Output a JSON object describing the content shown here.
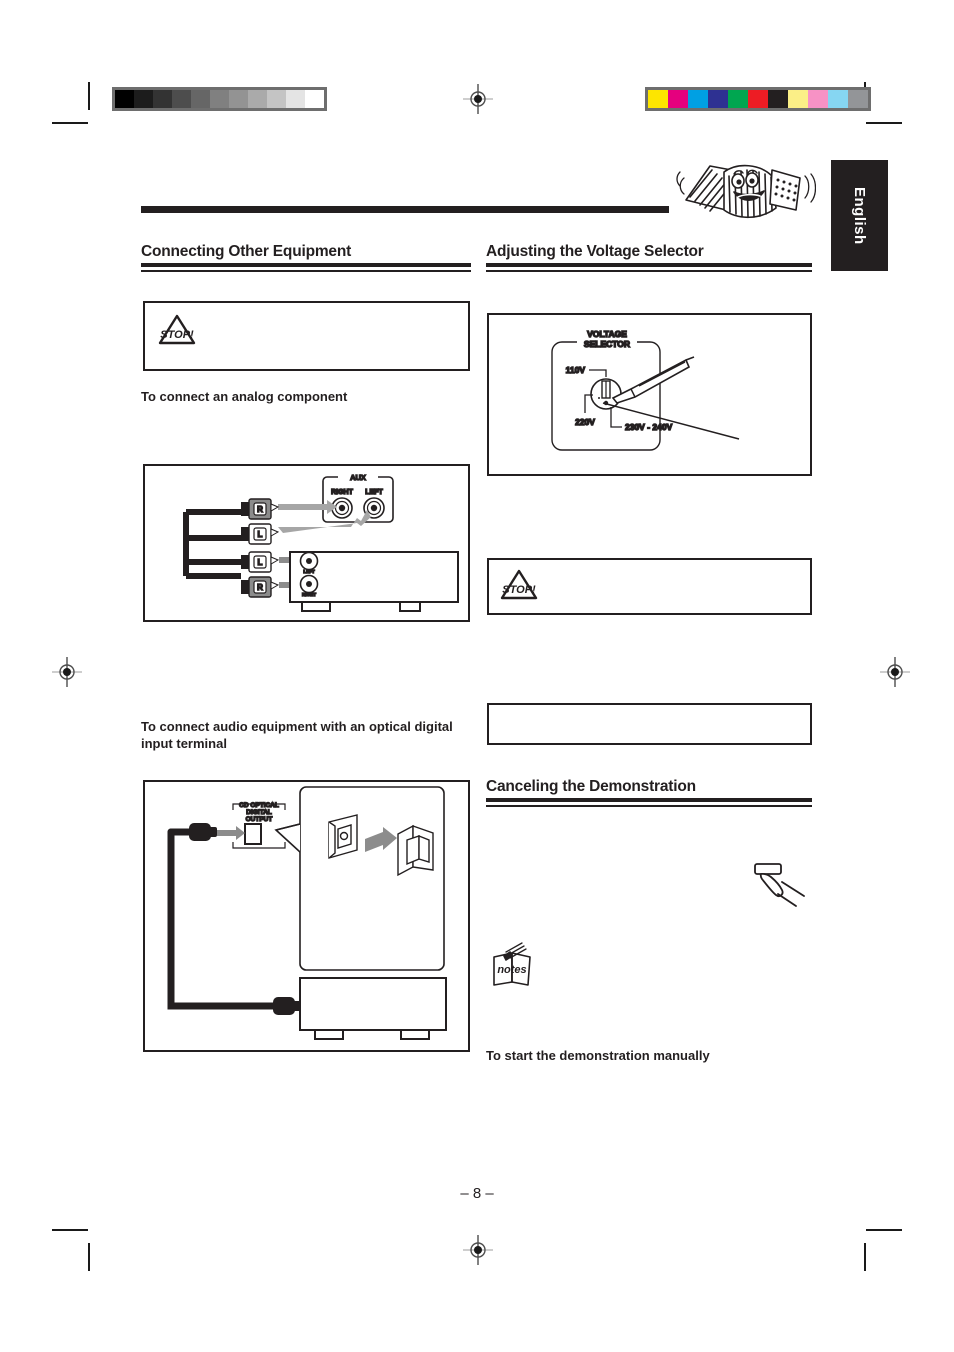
{
  "document": {
    "page_number": "– 8 –",
    "language_tab": "English"
  },
  "print_marks": {
    "grayscale_wedge": {
      "name": "grayscale-step-wedge",
      "steps": [
        "#000000",
        "#1c1c1c",
        "#333333",
        "#4d4d4d",
        "#666666",
        "#808080",
        "#939393",
        "#aaaaaa",
        "#c4c4c4",
        "#e4e4e4",
        "#ffffff"
      ]
    },
    "color_wedge": {
      "name": "color-calibration-bar",
      "steps": [
        "#fde500",
        "#e5007e",
        "#00a0e3",
        "#2e3192",
        "#00a650",
        "#ed1c24",
        "#231f20",
        "#fbef87",
        "#f792c5",
        "#86d6f2",
        "#939598"
      ]
    },
    "registration_mark_label": "registration-target"
  },
  "left_column": {
    "heading": "Connecting Other Equipment",
    "caution_box": {
      "icon": "stop-caution-icon",
      "icon_label": "STOP!",
      "body": ""
    },
    "subhead_analog": "To connect an analog component",
    "analog_figure": {
      "name": "analog-connection-diagram",
      "panel_label": "AUX",
      "jack_labels": [
        "RIGHT",
        "LEFT"
      ],
      "plug_labels": [
        "R",
        "L"
      ],
      "component_jack_labels": [
        "LEFT",
        "RIGHT"
      ]
    },
    "subhead_optical": "To connect audio equipment with an optical digital input terminal",
    "optical_figure": {
      "name": "optical-digital-connection-diagram",
      "terminal_label_lines": [
        "CD OPTICAL",
        "DIGITAL",
        "OUTPUT"
      ]
    }
  },
  "right_column": {
    "heading_voltage": "Adjusting the Voltage Selector",
    "voltage_figure": {
      "name": "voltage-selector-diagram",
      "title_lines": [
        "VOLTAGE",
        "SELECTOR"
      ],
      "labels": [
        "110V",
        "220V",
        "230V - 240V"
      ]
    },
    "caution_box": {
      "icon": "stop-caution-icon",
      "icon_label": "STOP!",
      "body": ""
    },
    "note_box": {
      "body": ""
    },
    "heading_demo": "Canceling the Demonstration",
    "hand_icon_label": "hand-pressing-button-icon",
    "notes_icon_label": "notes-icon",
    "notes_icon_text": "notes",
    "subhead_demo": "To start the demonstration manually"
  }
}
